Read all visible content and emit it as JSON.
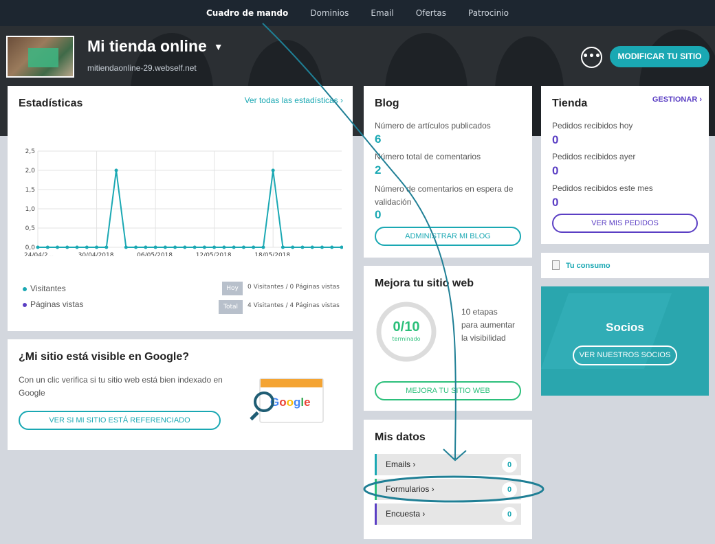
{
  "nav": {
    "items": [
      "Cuadro de mando",
      "Dominios",
      "Email",
      "Ofertas",
      "Patrocinio"
    ]
  },
  "header": {
    "site_title": "Mi tienda online",
    "site_url": "mitiendaonline-29.webself.net",
    "more_label": "•••",
    "modify_button": "MODIFICAR TU SITIO"
  },
  "stats": {
    "title": "Estadísticas",
    "link": "Ver todas las estadísticas ›",
    "legend": [
      {
        "label": "Visitantes",
        "color": "#1aa8b3"
      },
      {
        "label": "Páginas vistas",
        "color": "#5b3fc4"
      }
    ],
    "today_chip": "Hoy",
    "today_text": "0 Visitantes / 0 Páginas vistas",
    "total_chip": "Total",
    "total_text": "4 Visitantes / 4 Páginas vistas"
  },
  "chart_data": {
    "type": "line",
    "x_tick_labels": [
      "24/04/2...",
      "30/04/2018",
      "06/05/2018",
      "12/05/2018",
      "18/05/2018"
    ],
    "y_tick_labels": [
      "2,5",
      "2,0",
      "1,5",
      "1,0",
      "0,5",
      "0,0"
    ],
    "ylim": [
      0,
      2.5
    ],
    "series": [
      {
        "name": "Visitantes",
        "values": [
          0,
          0,
          0,
          0,
          0,
          0,
          0,
          0,
          2,
          0,
          0,
          0,
          0,
          0,
          0,
          0,
          0,
          0,
          0,
          0,
          0,
          0,
          0,
          0,
          2,
          0,
          0,
          0,
          0,
          0,
          0,
          0
        ]
      }
    ]
  },
  "google": {
    "title": "¿Mi sitio está visible en Google?",
    "text": "Con un clic verifica si tu sitio web está bien indexado en Google",
    "button": "VER SI MI SITIO ESTÁ REFERENCIADO",
    "logo_text": "Google"
  },
  "blog": {
    "title": "Blog",
    "items": [
      {
        "label": "Número de artículos publicados",
        "value": "6"
      },
      {
        "label": "Número total de comentarios",
        "value": "2"
      },
      {
        "label": "Número de comentarios en espera de validación",
        "value": "0"
      }
    ],
    "button": "ADMINISTRAR MI BLOG"
  },
  "improve": {
    "title": "Mejora tu sitio web",
    "progress": "0/10",
    "progress_sub": "terminado",
    "progress_fraction": 0,
    "text": "10 etapas para aumentar la visibilidad",
    "button": "MEJORA TU SITIO WEB"
  },
  "mydata": {
    "title": "Mis datos",
    "rows": [
      {
        "label": "Emails ›",
        "count": "0",
        "color": "#1aa8b3"
      },
      {
        "label": "Formularios ›",
        "count": "0",
        "color": "#2bbf7a"
      },
      {
        "label": "Encuesta ›",
        "count": "0",
        "color": "#5b3fc4"
      }
    ]
  },
  "store": {
    "title": "Tienda",
    "manage": "GESTIONAR ›",
    "items": [
      {
        "label": "Pedidos recibidos hoy",
        "value": "0"
      },
      {
        "label": "Pedidos recibidos ayer",
        "value": "0"
      },
      {
        "label": "Pedidos recibidos este mes",
        "value": "0"
      }
    ],
    "button": "VER MIS PEDIDOS"
  },
  "consumo": {
    "label": "Tu consumo"
  },
  "partners": {
    "title": "Socios",
    "button": "VER NUESTROS SOCIOS"
  }
}
